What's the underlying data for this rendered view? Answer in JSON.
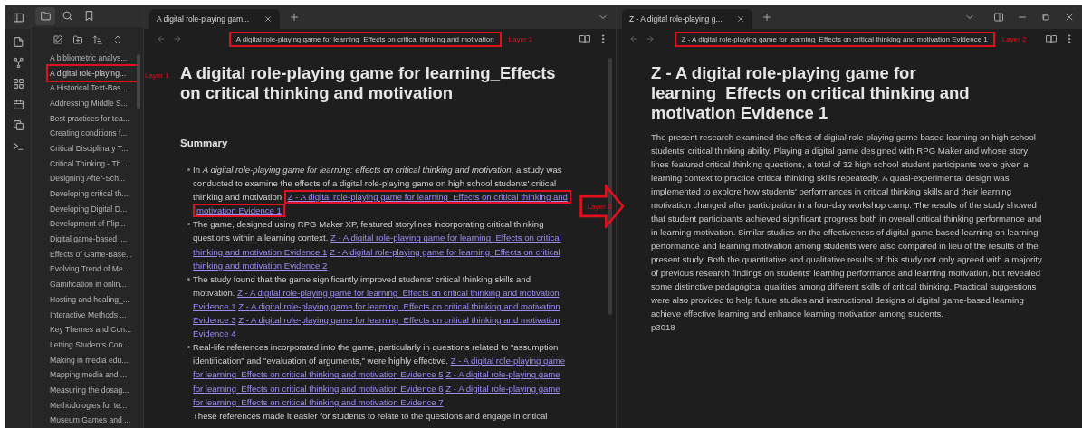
{
  "sidebar": {
    "view_tabs": [
      {
        "kind": "files",
        "selected": true
      },
      {
        "kind": "search",
        "selected": false
      },
      {
        "kind": "bookmarks",
        "selected": false
      }
    ],
    "files": [
      {
        "name": "A bibliometric analys...",
        "highlighted": false
      },
      {
        "name": "A digital role-playing...",
        "highlighted": true
      },
      {
        "name": "A Historical Text-Bas...",
        "highlighted": false
      },
      {
        "name": "Addressing Middle S...",
        "highlighted": false
      },
      {
        "name": "Best practices for tea...",
        "highlighted": false
      },
      {
        "name": "Creating conditions f...",
        "highlighted": false
      },
      {
        "name": "Critical Disciplinary T...",
        "highlighted": false
      },
      {
        "name": "Critical Thinking - Th...",
        "highlighted": false
      },
      {
        "name": "Designing After-Sch...",
        "highlighted": false
      },
      {
        "name": "Developing critical th...",
        "highlighted": false
      },
      {
        "name": "Developing Digital D...",
        "highlighted": false
      },
      {
        "name": "Development of Flip...",
        "highlighted": false
      },
      {
        "name": "Digital game-based l...",
        "highlighted": false
      },
      {
        "name": "Effects of Game-Base...",
        "highlighted": false
      },
      {
        "name": "Evolving Trend of Me...",
        "highlighted": false
      },
      {
        "name": "Gamification in onlin...",
        "highlighted": false
      },
      {
        "name": "Hosting and healing_...",
        "highlighted": false
      },
      {
        "name": "Interactive Methods ...",
        "highlighted": false
      },
      {
        "name": "Key Themes and Con...",
        "highlighted": false
      },
      {
        "name": "Letting Students Con...",
        "highlighted": false
      },
      {
        "name": "Making in media edu...",
        "highlighted": false
      },
      {
        "name": "Mapping media and ...",
        "highlighted": false
      },
      {
        "name": "Measuring the dosag...",
        "highlighted": false
      },
      {
        "name": "Methodologies for te...",
        "highlighted": false
      },
      {
        "name": "Museum Games and ...",
        "highlighted": false
      }
    ],
    "annotation": "Layer 1"
  },
  "panes": [
    {
      "tab": {
        "title": "A digital role-playing gam...",
        "selected": true
      },
      "breadcrumb": {
        "text": "A digital role-playing game for learning_Effects on critical thinking and motivation",
        "highlighted": true
      },
      "annotation": "Layer 1",
      "title": "A digital role-playing game for learning_Effects on critical thinking and motivation",
      "heading": "Summary",
      "bullets": [
        {
          "segments": [
            {
              "kind": "text",
              "text": "In *A digital role-playing game for learning: effects on critical thinking and motivation*, a study was conducted to examine the effects of a digital role-playing game on high school students' critical thinking and motivation"
            },
            {
              "kind": "link",
              "text": "Z - A digital role-playing game for learning_Effects on critical thinking and motivation Evidence 1",
              "highlighted": true
            }
          ]
        },
        {
          "segments": [
            {
              "kind": "text",
              "text": "The game, designed using RPG Maker XP, featured storylines incorporating critical thinking questions within a learning context."
            },
            {
              "kind": "link",
              "text": "Z - A digital role-playing game for learning_Effects on critical thinking and motivation Evidence 1",
              "highlighted": false
            },
            {
              "kind": "link",
              "text": "Z - A digital role-playing game for learning_Effects on critical thinking and motivation Evidence 2",
              "highlighted": false
            }
          ]
        },
        {
          "segments": [
            {
              "kind": "text",
              "text": "The study found that the game significantly improved students' critical thinking skills and motivation."
            },
            {
              "kind": "link",
              "text": "Z - A digital role-playing game for learning_Effects on critical thinking and motivation Evidence 1",
              "highlighted": false
            },
            {
              "kind": "link",
              "text": "Z - A digital role-playing game for learning_Effects on critical thinking and motivation Evidence 3",
              "highlighted": false
            },
            {
              "kind": "link",
              "text": "Z - A digital role-playing game for learning_Effects on critical thinking and motivation Evidence 4",
              "highlighted": false
            }
          ]
        },
        {
          "segments": [
            {
              "kind": "text",
              "text": "Real-life references incorporated into the game, particularly in questions related to \"assumption identification\" and \"evaluation of arguments,\" were highly effective."
            },
            {
              "kind": "link",
              "text": "Z - A digital role-playing game for learning_Effects on critical thinking and motivation Evidence 5",
              "highlighted": false
            },
            {
              "kind": "link",
              "text": "Z - A digital role-playing game for learning_Effects on critical thinking and motivation Evidence 6",
              "highlighted": false
            },
            {
              "kind": "link",
              "text": "Z - A digital role-playing game for learning_Effects on critical thinking and motivation Evidence 7",
              "highlighted": false
            },
            {
              "kind": "break"
            },
            {
              "kind": "text",
              "text": "These references made it easier for students to relate to the questions and engage in critical"
            }
          ]
        }
      ]
    },
    {
      "tab": {
        "title": "Z - A digital role-playing g...",
        "selected": true
      },
      "breadcrumb": {
        "text": "Z - A digital role-playing game for learning_Effects on critical thinking and motivation Evidence 1",
        "highlighted": true
      },
      "annotation": "Layer 2",
      "title": "Z - A digital role-playing game for learning_Effects on critical thinking and motivation Evidence 1",
      "paragraphs": [
        "The present research examined the effect of digital role-playing game based learning on high school students' critical thinking ability. Playing a digital game designed with RPG Maker and whose story lines featured critical thinking questions, a total of 32 high school student participants were given a learning context to practice critical thinking skills repeatedly. A quasi-experimental design was implemented to explore how students' performances in critical thinking skills and their learning motivation changed after participation in a four-day workshop camp. The results of the study showed that student participants achieved significant progress both in overall critical thinking performance and in learning motivation. Similar studies on the effectiveness of digital game-based learning on learning performance and learning motivation among students were also compared in lieu of the results of the present study. Both the quantitative and qualitative results of this study not only agreed with a majority of previous research findings on students' learning performance and learning motivation, but revealed some distinctive pedagogical qualities among different skills of critical thinking. Practical suggestions were also provided to help future studies and instructional designs of digital game-based learning achieve effective learning and enhance learning motivation among students.",
        "p3018"
      ],
      "window_controls": [
        {
          "kind": "split-view"
        },
        {
          "kind": "minimize"
        },
        {
          "kind": "restore"
        },
        {
          "kind": "close"
        }
      ]
    }
  ],
  "arrow_annotation": {
    "label": "Layer 2"
  }
}
